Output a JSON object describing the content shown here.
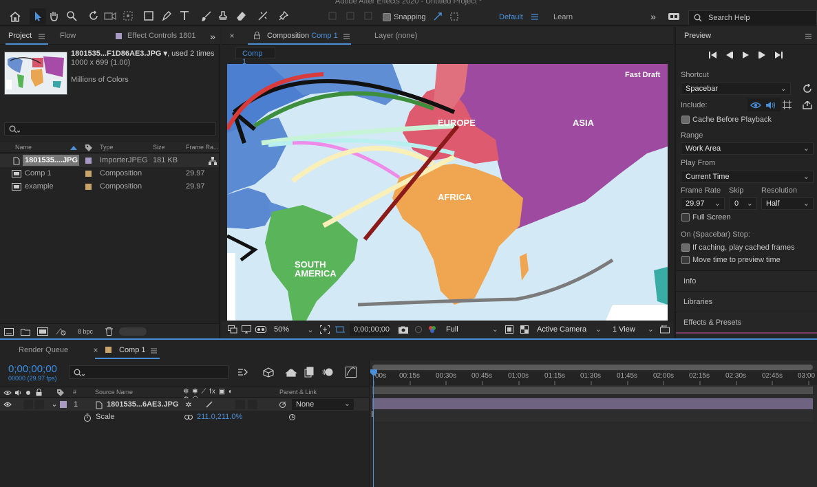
{
  "app": {
    "title": "Adobe After Effects 2020 - Untitled Project *"
  },
  "toolbar": {
    "snapping_label": "Snapping",
    "workspace_default": "Default",
    "workspace_learn": "Learn",
    "search_placeholder": "Search Help"
  },
  "project_panel": {
    "tabs": [
      "Project",
      "Flow",
      "Effect Controls 1801"
    ],
    "preview_filename": "1801535...F1D86AE3.JPG",
    "preview_used": ", used 2 times",
    "preview_dims": "1000 x 699 (1.00)",
    "preview_colors": "Millions of Colors",
    "columns": {
      "name": "Name",
      "type": "Type",
      "size": "Size",
      "frame_rate": "Frame Ra..."
    },
    "items": [
      {
        "name": "1801535....JPG",
        "type": "ImporterJPEG",
        "size": "181 KB",
        "fps": ""
      },
      {
        "name": "Comp 1",
        "type": "Composition",
        "size": "",
        "fps": "29.97"
      },
      {
        "name": "example",
        "type": "Composition",
        "size": "",
        "fps": "29.97"
      }
    ],
    "bpc": "8 bpc"
  },
  "comp_panel": {
    "tab_prefix": "Composition",
    "tab_name": "Comp 1",
    "layer_tab": "Layer (none)",
    "subtab": "Comp 1",
    "draft_label": "Fast Draft",
    "map_labels": {
      "europe": "EUROPE",
      "asia": "ASIA",
      "africa": "AFRICA",
      "south_america_1": "SOUTH",
      "south_america_2": "AMERICA"
    },
    "zoom": "50%",
    "timecode": "0;00;00;00",
    "resolution": "Full",
    "camera": "Active Camera",
    "views": "1 View"
  },
  "preview_panel": {
    "title": "Preview",
    "shortcut_label": "Shortcut",
    "shortcut_value": "Spacebar",
    "include_label": "Include:",
    "cache_before": "Cache Before Playback",
    "range_label": "Range",
    "range_value": "Work Area",
    "play_from_label": "Play From",
    "play_from_value": "Current Time",
    "frame_rate_label": "Frame Rate",
    "skip_label": "Skip",
    "resolution_label": "Resolution",
    "frame_rate_value": "29.97",
    "skip_value": "0",
    "resolution_value": "Half",
    "full_screen": "Full Screen",
    "stop_label": "On (Spacebar) Stop:",
    "if_caching": "If caching, play cached frames",
    "move_time": "Move time to preview time",
    "sections": [
      "Info",
      "Libraries",
      "Effects & Presets"
    ]
  },
  "timeline": {
    "tabs": [
      "Render Queue",
      "Comp 1"
    ],
    "timecode": "0;00;00;00",
    "frame_info": "00000 (29.97 fps)",
    "col_source": "Source Name",
    "col_parent": "Parent & Link",
    "col_num": "#",
    "layer_num": "1",
    "layer_name": "1801535...6AE3.JPG",
    "parent_value": "None",
    "prop_name": "Scale",
    "prop_value": "211.0,211.0%",
    "ruler": [
      "00s",
      "00:15s",
      "00:30s",
      "00:45s",
      "01:00s",
      "01:15s",
      "01:30s",
      "01:45s",
      "02:00s",
      "02:15s",
      "02:30s",
      "02:45s",
      "03:00"
    ]
  },
  "colors": {
    "accent": "#4a90d9",
    "timecode": "#3a8ee6",
    "layer_bar": "#6e6380",
    "label_lavender": "#a89ac4",
    "label_tan": "#c9a46a"
  }
}
